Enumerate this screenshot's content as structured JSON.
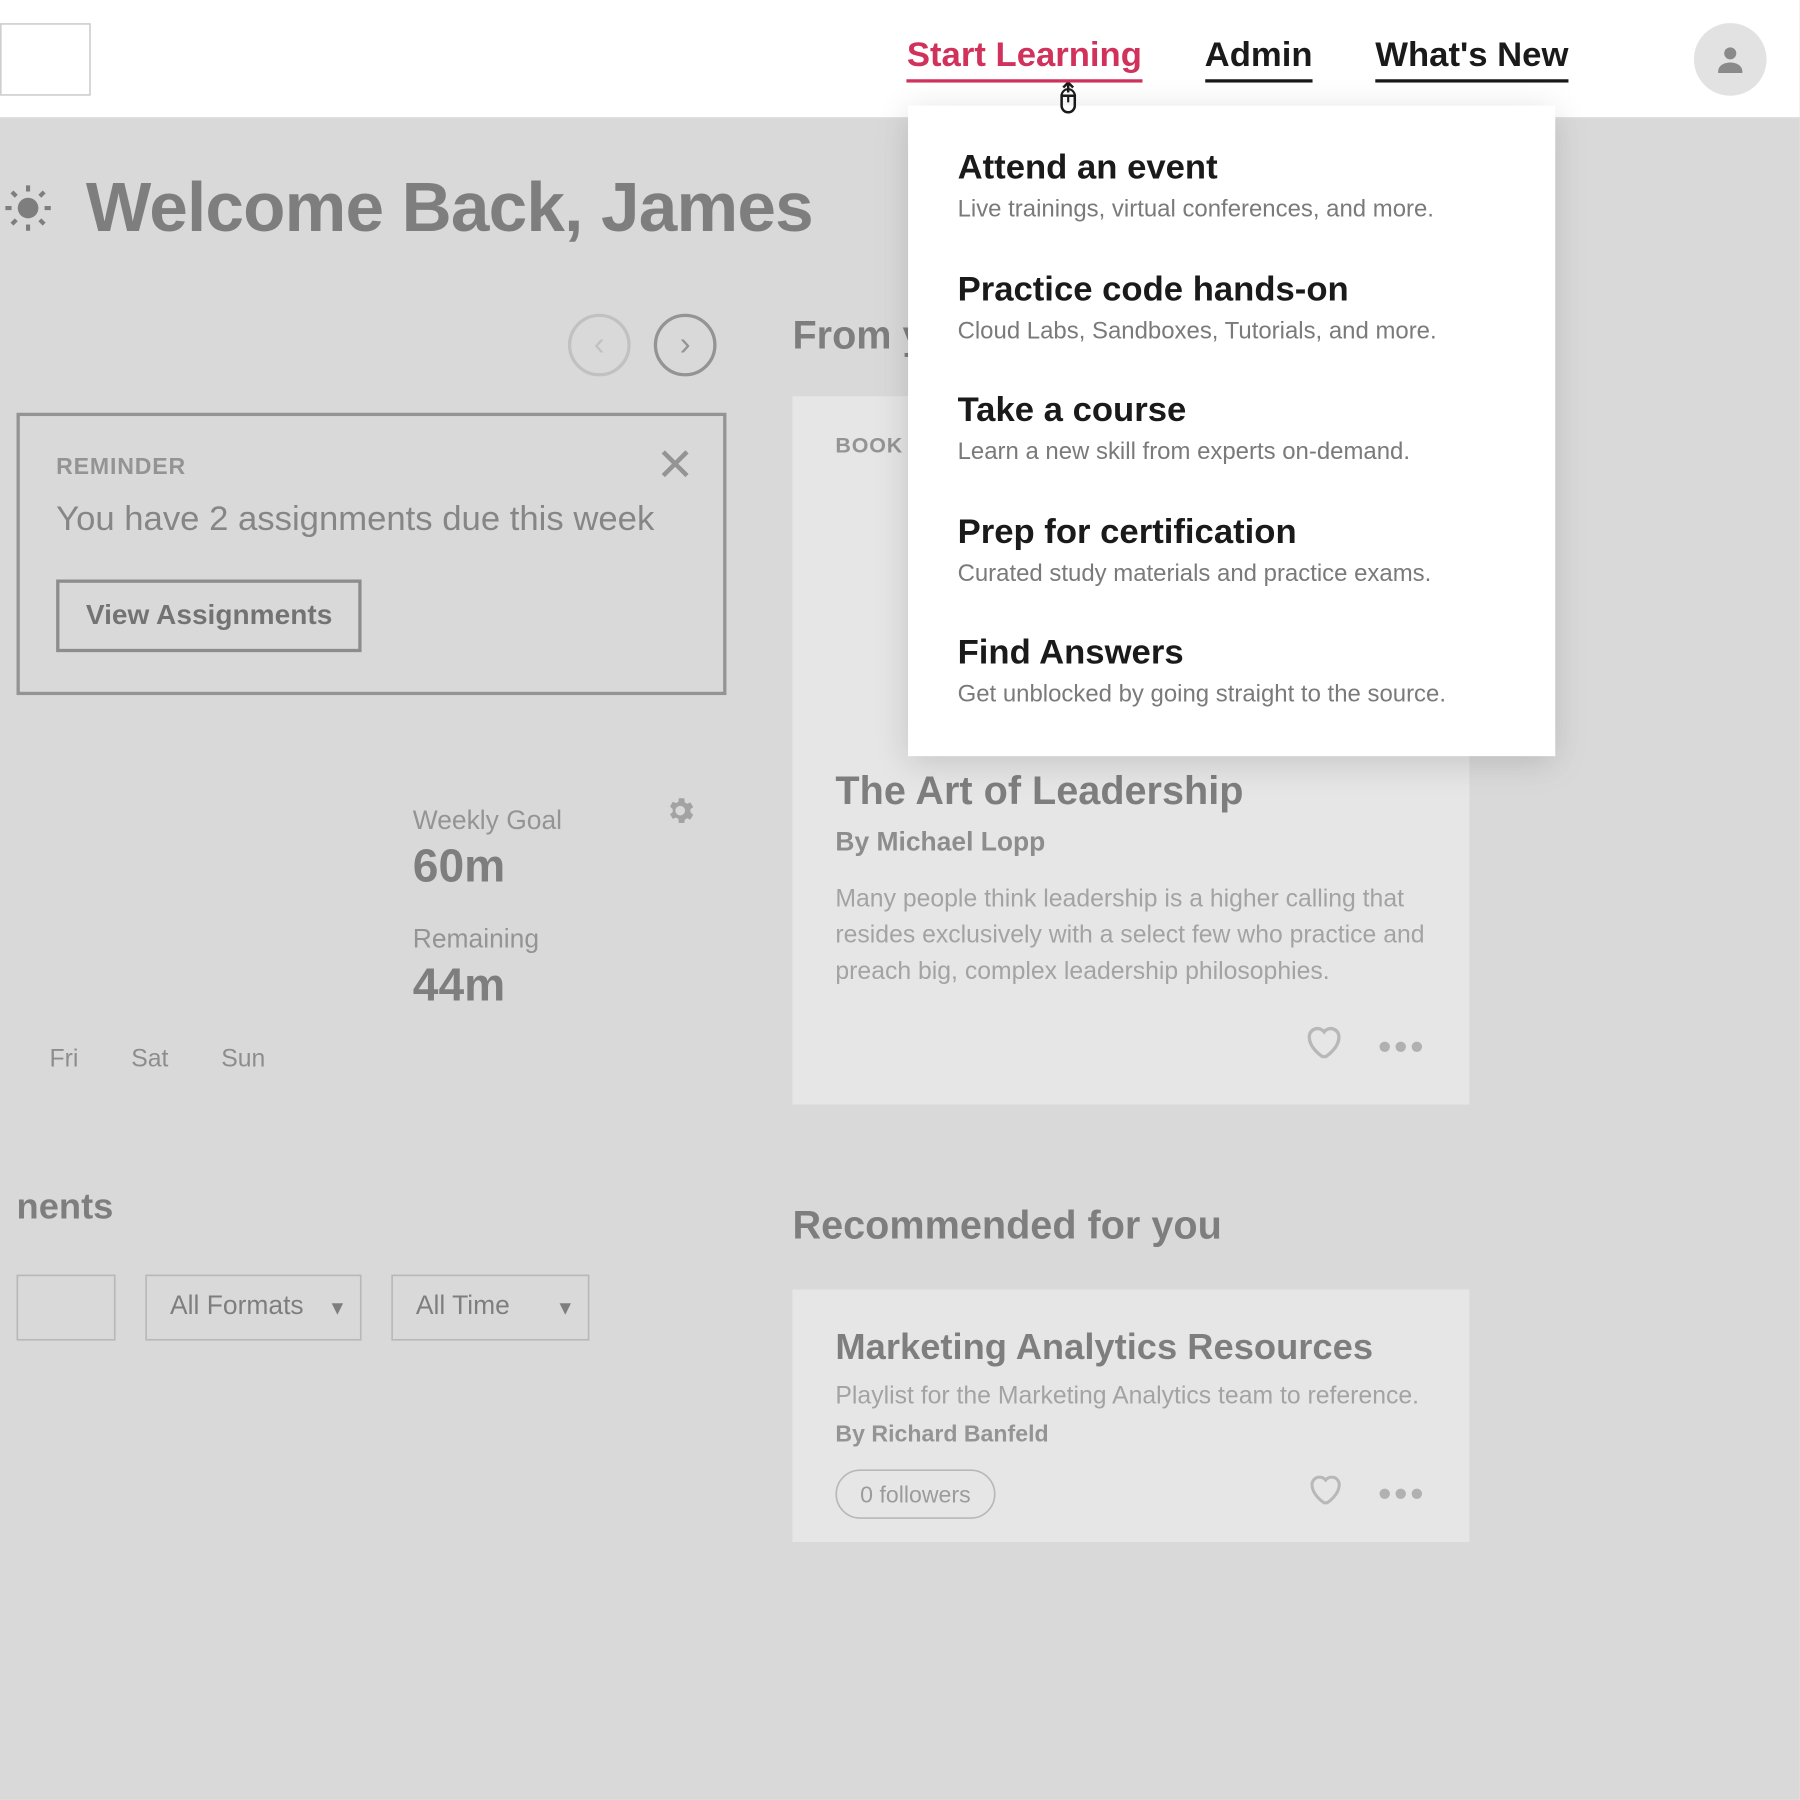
{
  "nav": {
    "start_learning": "Start Learning",
    "admin": "Admin",
    "whats_new": "What's New"
  },
  "dropdown": {
    "items": [
      {
        "title": "Attend an event",
        "desc": "Live trainings, virtual conferences, and more."
      },
      {
        "title": "Practice code hands-on",
        "desc": "Cloud Labs, Sandboxes, Tutorials, and more."
      },
      {
        "title": "Take a course",
        "desc": "Learn a new skill from experts on-demand."
      },
      {
        "title": "Prep for certification",
        "desc": "Curated study materials and practice exams."
      },
      {
        "title": "Find Answers",
        "desc": "Get unblocked by going straight to the source."
      }
    ]
  },
  "welcome": {
    "title": "Welcome Back, James"
  },
  "reminder": {
    "label": "REMINDER",
    "text": "You have 2 assignments due this week",
    "button": "View Assignments"
  },
  "goal": {
    "weekly_label": "Weekly Goal",
    "weekly_value": "60m",
    "remaining_label": "Remaining",
    "remaining_value": "44m",
    "days": [
      "Fri",
      "Sat",
      "Sun"
    ]
  },
  "assignments": {
    "heading_fragment": "nents",
    "filters": {
      "format": "All Formats",
      "time": "All Time"
    }
  },
  "from_your": {
    "heading_fragment": "From yo"
  },
  "book": {
    "label": "BOOK",
    "title": "The Art of Leadership",
    "author": "By Michael Lopp",
    "desc": "Many people think leadership is a higher calling that resides exclusively with a select few who practice and preach big, complex leadership philosophies."
  },
  "recommended": {
    "heading": "Recommended for you",
    "card": {
      "title": "Marketing Analytics Resources",
      "sub": "Playlist for the Marketing Analytics team to reference.",
      "author": "By Richard Banfeld",
      "followers": "0 followers"
    }
  }
}
